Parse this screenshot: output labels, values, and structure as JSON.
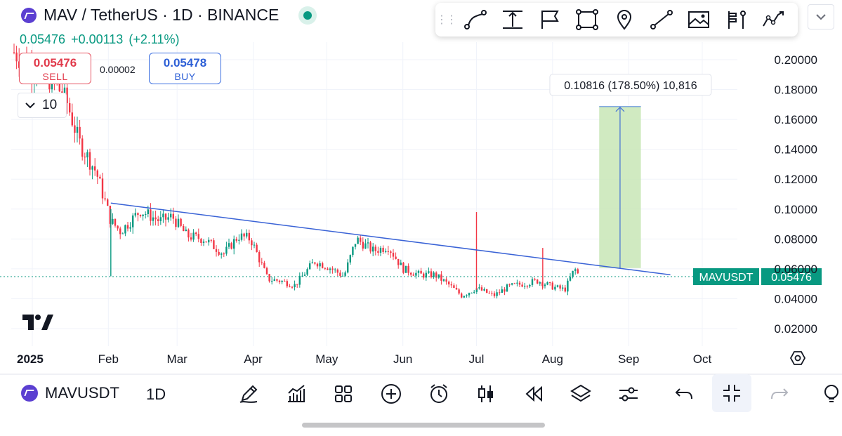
{
  "header": {
    "title": "MAV / TetherUS · 1D · BINANCE",
    "last_price": "0.05476",
    "change": "+0.00113",
    "change_pct": "(+2.11%)"
  },
  "trade": {
    "sell_price": "0.05476",
    "sell_label": "SELL",
    "spread": "0.00002",
    "buy_price": "0.05478",
    "buy_label": "BUY"
  },
  "quantity": {
    "value": "10"
  },
  "drawing_toolbar": {
    "tools": [
      "trendline-icon",
      "measure-icon",
      "flag-icon",
      "rectangle-icon",
      "pin-icon",
      "line-icon",
      "image-icon",
      "fib-icon",
      "path-icon"
    ]
  },
  "price_label": {
    "symbol": "MAVUSDT",
    "value": "0.05476"
  },
  "measure_label": "0.10816 (178.50%) 10,816",
  "bottom_bar": {
    "symbol": "MAVUSDT",
    "interval": "1D",
    "tools": [
      "pencil-icon",
      "indicators-icon",
      "layout-icon",
      "add-icon",
      "alert-icon",
      "candles-icon",
      "replay-icon",
      "layers-icon",
      "settings-icon",
      "undo-icon",
      "collapse-icon",
      "redo-icon"
    ]
  },
  "colors": {
    "up": "#089981",
    "down": "#f23645",
    "trendline": "#3a63d6",
    "measure_fill": "#c8e6b6",
    "price_tag": "#089981"
  },
  "chart_data": {
    "type": "candlestick",
    "y_ticks": [
      "0.20000",
      "0.18000",
      "0.16000",
      "0.14000",
      "0.12000",
      "0.10000",
      "0.08000",
      "0.06000",
      "0.04000",
      "0.02000"
    ],
    "ylim": [
      0.0,
      0.21
    ],
    "x_ticks": [
      "2025",
      "Feb",
      "Mar",
      "Apr",
      "May",
      "Jun",
      "Jul",
      "Aug",
      "Sep",
      "Oct"
    ],
    "x_tick_dates": [
      "2025-01-01",
      "2025-02-01",
      "2025-03-01",
      "2025-04-01",
      "2025-05-01",
      "2025-06-01",
      "2025-07-01",
      "2025-08-01",
      "2025-09-01",
      "2025-10-01"
    ],
    "close_series": [
      {
        "date": "2025-01-01",
        "price": 0.195
      },
      {
        "date": "2025-01-10",
        "price": 0.185
      },
      {
        "date": "2025-01-15",
        "price": 0.172
      },
      {
        "date": "2025-01-20",
        "price": 0.145
      },
      {
        "date": "2025-01-27",
        "price": 0.125
      },
      {
        "date": "2025-02-02",
        "price": 0.092
      },
      {
        "date": "2025-02-06",
        "price": 0.085
      },
      {
        "date": "2025-02-14",
        "price": 0.099
      },
      {
        "date": "2025-02-22",
        "price": 0.092
      },
      {
        "date": "2025-02-27",
        "price": 0.095
      },
      {
        "date": "2025-03-05",
        "price": 0.082
      },
      {
        "date": "2025-03-12",
        "price": 0.08
      },
      {
        "date": "2025-03-20",
        "price": 0.07
      },
      {
        "date": "2025-03-26",
        "price": 0.082
      },
      {
        "date": "2025-03-31",
        "price": 0.08
      },
      {
        "date": "2025-04-07",
        "price": 0.053
      },
      {
        "date": "2025-04-12",
        "price": 0.052
      },
      {
        "date": "2025-04-18",
        "price": 0.049
      },
      {
        "date": "2025-04-26",
        "price": 0.065
      },
      {
        "date": "2025-05-02",
        "price": 0.061
      },
      {
        "date": "2025-05-08",
        "price": 0.055
      },
      {
        "date": "2025-05-13",
        "price": 0.08
      },
      {
        "date": "2025-05-20",
        "price": 0.072
      },
      {
        "date": "2025-05-26",
        "price": 0.075
      },
      {
        "date": "2025-06-01",
        "price": 0.06
      },
      {
        "date": "2025-06-08",
        "price": 0.056
      },
      {
        "date": "2025-06-14",
        "price": 0.056
      },
      {
        "date": "2025-06-20",
        "price": 0.049
      },
      {
        "date": "2025-06-25",
        "price": 0.042
      },
      {
        "date": "2025-07-01",
        "price": 0.047
      },
      {
        "date": "2025-07-08",
        "price": 0.042
      },
      {
        "date": "2025-07-14",
        "price": 0.048
      },
      {
        "date": "2025-07-20",
        "price": 0.05
      },
      {
        "date": "2025-07-26",
        "price": 0.052
      },
      {
        "date": "2025-08-01",
        "price": 0.048
      },
      {
        "date": "2025-08-06",
        "price": 0.046
      },
      {
        "date": "2025-08-10",
        "price": 0.06
      },
      {
        "date": "2025-08-12",
        "price": 0.0548
      }
    ],
    "wicks": [
      {
        "date": "2025-02-02",
        "high": 0.1,
        "low": 0.055
      },
      {
        "date": "2025-07-01",
        "high": 0.098,
        "low": 0.046
      },
      {
        "date": "2025-07-28",
        "high": 0.074,
        "low": 0.047
      }
    ],
    "trendline": {
      "start": {
        "date": "2025-02-02",
        "price": 0.104
      },
      "end": {
        "date": "2025-09-18",
        "price": 0.056
      }
    },
    "last_price_line": 0.05476,
    "price_range_measure": {
      "date_start": "2025-08-20",
      "date_end": "2025-09-06",
      "price_from": 0.0605,
      "price_to": 0.1686
    },
    "grid": true
  }
}
